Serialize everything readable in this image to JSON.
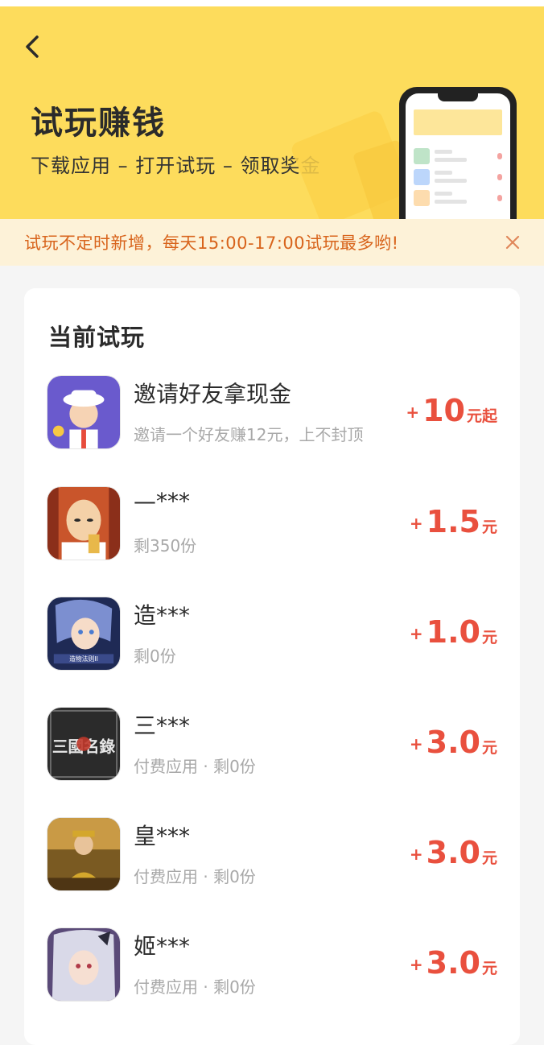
{
  "header": {
    "title": "试玩赚钱",
    "subtitle": "下载应用 – 打开试玩 – 领取奖金"
  },
  "notice": {
    "text": "试玩不定时新增，每天15:00-17:00试玩最多哟!"
  },
  "card": {
    "title": "当前试玩",
    "items": [
      {
        "name": "邀请好友拿现金",
        "sub": "邀请一个好友赚12元，上不封顶",
        "plus": "+",
        "amount": "10",
        "unit": "元起"
      },
      {
        "name": "—***",
        "sub": "剩350份",
        "plus": "+",
        "amount": "1.5",
        "unit": "元"
      },
      {
        "name": "造***",
        "sub": "剩0份",
        "plus": "+",
        "amount": "1.0",
        "unit": "元"
      },
      {
        "name": "三***",
        "sub": "付费应用 · 剩0份",
        "plus": "+",
        "amount": "3.0",
        "unit": "元"
      },
      {
        "name": "皇***",
        "sub": "付费应用 · 剩0份",
        "plus": "+",
        "amount": "3.0",
        "unit": "元"
      },
      {
        "name": "姬***",
        "sub": "付费应用 · 剩0份",
        "plus": "+",
        "amount": "3.0",
        "unit": "元"
      }
    ]
  },
  "icon_art": {
    "icon_1_label": "三國名錄",
    "icon_2_badge": "造物法则II"
  },
  "colors": {
    "header_bg": "#fddc5c",
    "notice_bg": "#fdf2d8",
    "notice_text": "#d8641c",
    "reward": "#e9503e"
  },
  "icons": {
    "back": "chevron-left-icon",
    "close": "close-icon"
  }
}
